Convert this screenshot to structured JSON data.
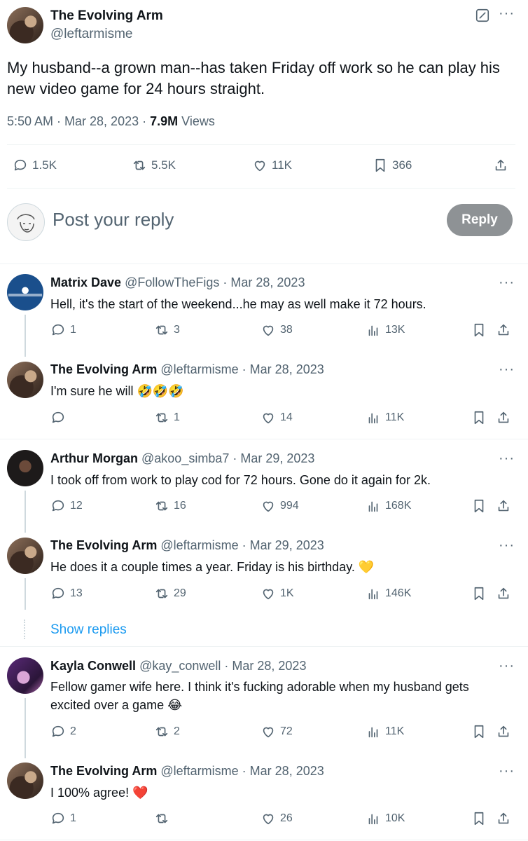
{
  "main_tweet": {
    "author_name": "The Evolving Arm",
    "author_handle": "@leftarmisme",
    "text_line1": "My husband--a grown man--has taken Friday off work so he can play his",
    "text_line2": "new video game for 24 hours straight.",
    "timestamp": "5:50 AM · Mar 28, 2023 · ",
    "views_count": "7.9M",
    "views_label": " Views",
    "replies": "1.5K",
    "retweets": "5.5K",
    "likes": "11K",
    "bookmarks": "366"
  },
  "composer": {
    "placeholder": "Post your reply",
    "reply_button": "Reply"
  },
  "replies": [
    {
      "name": "Matrix Dave",
      "handle": "@FollowTheFigs",
      "date": " · Mar 28, 2023",
      "line1": "Hell, it's the start of the weekend...he may as well make it 72 hours.",
      "comments": "1",
      "retweets": "3",
      "likes": "38",
      "views": "13K"
    },
    {
      "name": "The Evolving Arm",
      "handle": "@leftarmisme",
      "date": " · Mar 28, 2023",
      "line1": "I'm sure he will ",
      "emoji": "🤣🤣🤣",
      "comments": "",
      "retweets": "1",
      "likes": "14",
      "views": "11K"
    },
    {
      "name": "Arthur Morgan",
      "handle": "@akoo_simba7",
      "date": " · Mar 29, 2023",
      "line1": "I took off from work to play cod for 72 hours. Gone do it again for 2k.",
      "comments": "12",
      "retweets": "16",
      "likes": "994",
      "views": "168K"
    },
    {
      "name": "The Evolving Arm",
      "handle": "@leftarmisme",
      "date": " · Mar 29, 2023",
      "line1": "He does it a couple times a year. Friday is his birthday. ",
      "emoji": "💛",
      "comments": "13",
      "retweets": "29",
      "likes": "1K",
      "views": "146K"
    },
    {
      "name": "Kayla Conwell",
      "handle": "@kay_conwell",
      "date": " · Mar 28, 2023",
      "line1": "Fellow gamer wife here.  I think it's fucking adorable when my husband gets",
      "line2": "excited over a game ",
      "emoji": "😂",
      "comments": "2",
      "retweets": "2",
      "likes": "72",
      "views": "11K"
    },
    {
      "name": "The Evolving Arm",
      "handle": "@leftarmisme",
      "date": " · Mar 28, 2023",
      "line1": "I 100% agree! ",
      "emoji": "❤️",
      "comments": "1",
      "retweets": "",
      "likes": "26",
      "views": "10K"
    }
  ],
  "show_replies": "Show replies",
  "more_menu": "···",
  "colors": {
    "link": "#1d9bf0",
    "muted": "#536471",
    "reply_button": "#8e9295"
  },
  "icons": [
    "grok-icon",
    "more-icon",
    "reply-icon",
    "retweet-icon",
    "like-icon",
    "bookmark-icon",
    "share-icon",
    "views-icon"
  ]
}
